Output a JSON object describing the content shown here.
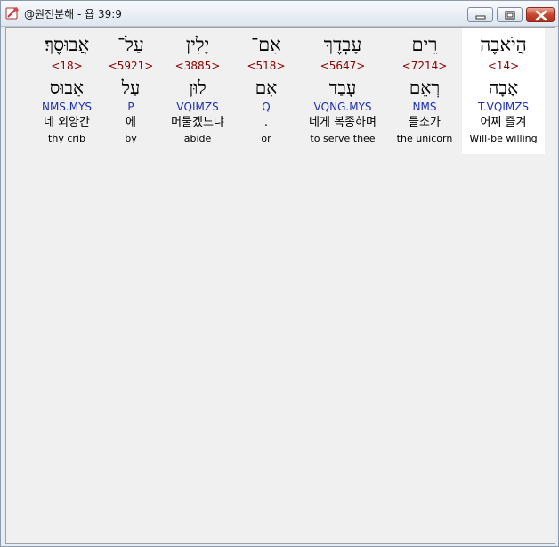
{
  "window": {
    "title": "@원전분해 - 욥 39:9",
    "controls": {
      "minimize": "minimize",
      "maximize": "maximize",
      "close": "close"
    }
  },
  "words": [
    {
      "hebrew": "הֲיֹאבֶה",
      "strong": "<14>",
      "root": "אָבָה",
      "morph": "T.VQIMZS",
      "korean": "어찌 즐겨",
      "english": "Will-be willing"
    },
    {
      "hebrew": "רֵים",
      "strong": "<7214>",
      "root": "רְאֵם",
      "morph": "NMS",
      "korean": "들소가",
      "english": "the unicorn"
    },
    {
      "hebrew": "עָבְדֶךָ",
      "strong": "<5647>",
      "root": "עָבַד",
      "morph": "VQNG.MYS",
      "korean": "네게 복종하며",
      "english": "to serve thee"
    },
    {
      "hebrew": "אִם־",
      "strong": "<518>",
      "root": "אִם",
      "morph": "Q",
      "korean": ".",
      "english": "or"
    },
    {
      "hebrew": "יָלִין",
      "strong": "<3885>",
      "root": "לוּן",
      "morph": "VQIMZS",
      "korean": "머물겠느냐",
      "english": "abide"
    },
    {
      "hebrew": "עַל־",
      "strong": "<5921>",
      "root": "עַל",
      "morph": "P",
      "korean": "에",
      "english": "by"
    },
    {
      "hebrew": "אֲבוּסֶךָ׃",
      "strong": "<18>",
      "root": "אֵבוּס",
      "morph": "NMS.MYS",
      "korean": "네 외양간",
      "english": "thy crib"
    }
  ],
  "colors": {
    "strong": "#8b0000",
    "morph": "#1e2fb4",
    "selected_bg": "#ffffff"
  },
  "selected_word_index": 0
}
